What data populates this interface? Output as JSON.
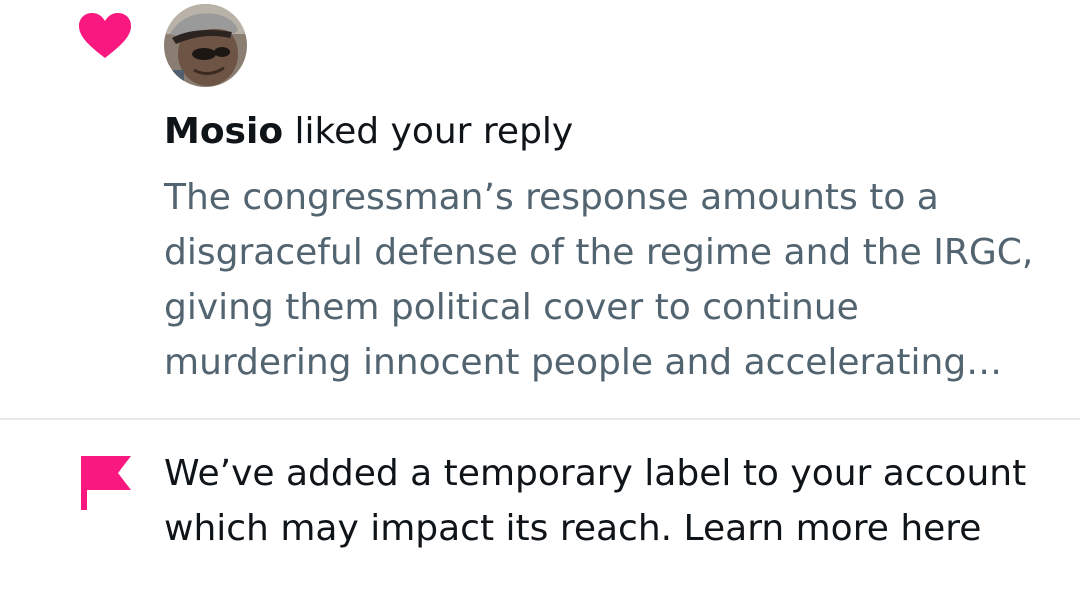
{
  "colors": {
    "heart": "#f91880",
    "flag": "#f91880",
    "primary_text": "#0f1419",
    "secondary_text": "#536471",
    "divider": "#e6e9eb"
  },
  "like_notification": {
    "icon": "heart-icon",
    "user_name": "Mosio",
    "action_text": " liked your reply",
    "reply_text": "The congressman’s response amounts to a disgraceful defense of the regime and the IRGC, giving them political cover to continue murdering innocent people and accelerating…"
  },
  "account_label_notification": {
    "icon": "flag-icon",
    "message": "We’ve added a temporary label to your account which may impact its reach. Learn more here"
  }
}
